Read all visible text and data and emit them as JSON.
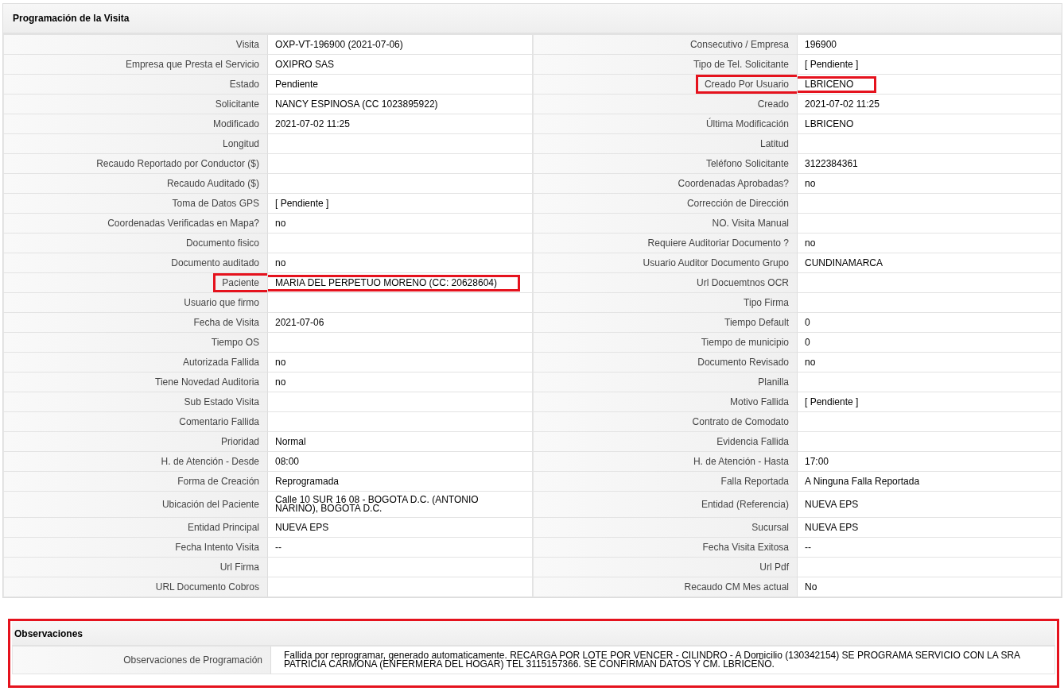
{
  "sections": [
    {
      "title": "Programación de la Visita",
      "highlighted": false,
      "rows": [
        {
          "cells": [
            {
              "label": "Visita",
              "value": "OXP-VT-196900 (2021-07-06)",
              "highlighted": false
            },
            {
              "label": "Consecutivo / Empresa",
              "value": "196900",
              "highlighted": false
            }
          ]
        },
        {
          "cells": [
            {
              "label": "Empresa que Presta el Servicio",
              "value": "OXIPRO SAS",
              "highlighted": false
            },
            {
              "label": "Tipo de Tel. Solicitante",
              "value": "[ Pendiente ]",
              "highlighted": false
            }
          ]
        },
        {
          "cells": [
            {
              "label": "Estado",
              "value": "Pendiente",
              "highlighted": false
            },
            {
              "label": "Creado Por Usuario",
              "value": "LBRICENO",
              "highlighted": true
            }
          ]
        },
        {
          "cells": [
            {
              "label": "Solicitante",
              "value": "NANCY ESPINOSA (CC 1023895922)",
              "highlighted": false
            },
            {
              "label": "Creado",
              "value": "2021-07-02 11:25",
              "highlighted": false
            }
          ]
        },
        {
          "cells": [
            {
              "label": "Modificado",
              "value": "2021-07-02 11:25",
              "highlighted": false
            },
            {
              "label": "Última Modificación",
              "value": "LBRICENO",
              "highlighted": false
            }
          ]
        },
        {
          "cells": [
            {
              "label": "Longitud",
              "highlighted": false
            },
            {
              "label": "Latitud",
              "highlighted": false
            }
          ]
        },
        {
          "cells": [
            {
              "label": "Recaudo Reportado por Conductor ($)",
              "highlighted": false
            },
            {
              "label": "Teléfono Solicitante",
              "value": "3122384361",
              "highlighted": false
            }
          ]
        },
        {
          "cells": [
            {
              "label": "Recaudo Auditado ($)",
              "highlighted": false
            },
            {
              "label": "Coordenadas Aprobadas?",
              "value": "no",
              "highlighted": false
            }
          ]
        },
        {
          "cells": [
            {
              "label": "Toma de Datos GPS",
              "value": "[ Pendiente ]",
              "highlighted": false
            },
            {
              "label": "Corrección de Dirección",
              "highlighted": false
            }
          ]
        },
        {
          "cells": [
            {
              "label": "Coordenadas Verificadas en Mapa?",
              "value": "no",
              "highlighted": false
            },
            {
              "label": "NO. Visita Manual",
              "highlighted": false
            }
          ]
        },
        {
          "cells": [
            {
              "label": "Documento fisico",
              "highlighted": false
            },
            {
              "label": "Requiere Auditoriar Documento ?",
              "value": "no",
              "highlighted": false
            }
          ]
        },
        {
          "cells": [
            {
              "label": "Documento auditado",
              "value": "no",
              "highlighted": false
            },
            {
              "label": "Usuario Auditor Documento Grupo",
              "value": "CUNDINAMARCA",
              "highlighted": false
            }
          ]
        },
        {
          "cells": [
            {
              "label": "Paciente",
              "value": "MARIA DEL PERPETUO MORENO (CC: 20628604)",
              "highlighted": true
            },
            {
              "label": "Url Docuemtnos OCR",
              "highlighted": false
            }
          ]
        },
        {
          "cells": [
            {
              "label": "Usuario que firmo",
              "highlighted": false
            },
            {
              "label": "Tipo Firma",
              "highlighted": false
            }
          ]
        },
        {
          "cells": [
            {
              "label": "Fecha de Visita",
              "value": "2021-07-06",
              "highlighted": false
            },
            {
              "label": "Tiempo Default",
              "value": "0",
              "highlighted": false
            }
          ]
        },
        {
          "cells": [
            {
              "label": "Tiempo OS",
              "highlighted": false
            },
            {
              "label": "Tiempo de municipio",
              "value": "0",
              "highlighted": false
            }
          ]
        },
        {
          "cells": [
            {
              "label": "Autorizada Fallida",
              "value": "no",
              "highlighted": false
            },
            {
              "label": "Documento Revisado",
              "value": "no",
              "highlighted": false
            }
          ]
        },
        {
          "cells": [
            {
              "label": "Tiene Novedad Auditoria",
              "value": "no",
              "highlighted": false
            },
            {
              "label": "Planilla",
              "highlighted": false
            }
          ]
        },
        {
          "cells": [
            {
              "label": "Sub Estado Visita",
              "highlighted": false
            },
            {
              "label": "Motivo Fallida",
              "value": "[ Pendiente ]",
              "highlighted": false
            }
          ]
        },
        {
          "cells": [
            {
              "label": "Comentario Fallida",
              "highlighted": false
            },
            {
              "label": "Contrato de Comodato",
              "highlighted": false
            }
          ]
        },
        {
          "cells": [
            {
              "label": "Prioridad",
              "value": "Normal",
              "highlighted": false
            },
            {
              "label": "Evidencia Fallida",
              "highlighted": false
            }
          ]
        },
        {
          "cells": [
            {
              "label": "H. de Atención - Desde",
              "value": "08:00",
              "highlighted": false
            },
            {
              "label": "H. de Atención - Hasta",
              "value": "17:00",
              "highlighted": false
            }
          ]
        },
        {
          "cells": [
            {
              "label": "Forma de Creación",
              "value": "Reprogramada",
              "highlighted": false
            },
            {
              "label": "Falla Reportada",
              "value": "A Ninguna Falla Reportada",
              "highlighted": false
            }
          ]
        },
        {
          "cells": [
            {
              "label": "Ubicación del Paciente",
              "value": "Calle 10 SUR 16 08 - BOGOTA D.C. (ANTONIO NARINO), BOGOTA D.C.",
              "highlighted": false
            },
            {
              "label": "Entidad (Referencia)",
              "value": "NUEVA EPS",
              "highlighted": false
            }
          ]
        },
        {
          "cells": [
            {
              "label": "Entidad Principal",
              "value": "NUEVA EPS",
              "highlighted": false
            },
            {
              "label": "Sucursal",
              "value": "NUEVA EPS",
              "highlighted": false
            }
          ]
        },
        {
          "cells": [
            {
              "label": "Fecha Intento Visita",
              "value": "--",
              "highlighted": false
            },
            {
              "label": "Fecha Visita Exitosa",
              "value": "--",
              "highlighted": false
            }
          ]
        },
        {
          "cells": [
            {
              "label": "Url Firma",
              "highlighted": false
            },
            {
              "label": "Url Pdf",
              "highlighted": false
            }
          ]
        },
        {
          "cells": [
            {
              "label": "URL Documento Cobros",
              "highlighted": false
            },
            {
              "label": "Recaudo CM Mes actual",
              "value": "No",
              "highlighted": false
            }
          ]
        }
      ]
    },
    {
      "title": "Observaciones",
      "highlighted": true,
      "rows": [
        {
          "cells": [
            {
              "label": "Observaciones de Programación",
              "value": "Fallida por reprogramar, generado automaticamente. RECARGA POR LOTE POR VENCER - CILINDRO - A Domicilio (130342154) SE PROGRAMA SERVICIO CON LA SRA PATRICIA CARMONA (ENFERMERA DEL HOGAR) TEL 3115157366. SE CONFIRMAN DATOS Y CM. LBRICEÑO.",
              "highlighted": false
            }
          ]
        }
      ]
    }
  ]
}
